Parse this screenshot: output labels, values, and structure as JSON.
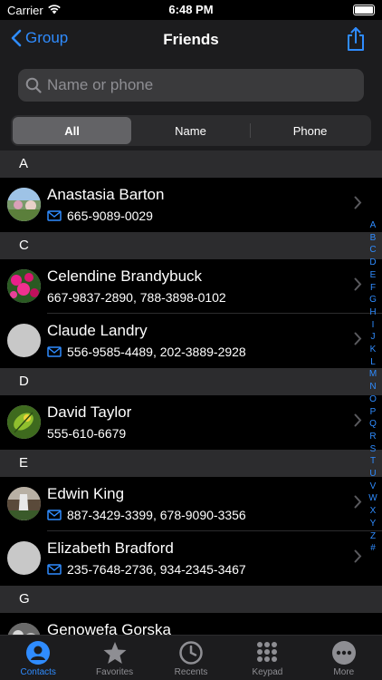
{
  "status_bar": {
    "carrier": "Carrier",
    "time": "6:48 PM"
  },
  "nav": {
    "back_label": "Group",
    "title": "Friends"
  },
  "search": {
    "placeholder": "Name or phone"
  },
  "segments": [
    "All",
    "Name",
    "Phone"
  ],
  "sections": [
    {
      "letter": "A",
      "contacts": [
        {
          "name": "Anastasia Barton",
          "detail": "665-9089-0029",
          "mail_icon": true,
          "avatar": "landscape"
        }
      ]
    },
    {
      "letter": "C",
      "contacts": [
        {
          "name": "Celendine Brandybuck",
          "detail": "667-9837-2890, 788-3898-0102",
          "mail_icon": false,
          "avatar": "flowers"
        },
        {
          "name": "Claude Landry",
          "detail": "556-9585-4489, 202-3889-2928",
          "mail_icon": true,
          "avatar": "blank"
        }
      ]
    },
    {
      "letter": "D",
      "contacts": [
        {
          "name": "David Taylor",
          "detail": "555-610-6679",
          "mail_icon": false,
          "avatar": "leaf"
        }
      ]
    },
    {
      "letter": "E",
      "contacts": [
        {
          "name": "Edwin King",
          "detail": "887-3429-3399, 678-9090-3356",
          "mail_icon": true,
          "avatar": "waterfall"
        },
        {
          "name": "Elizabeth Bradford",
          "detail": "235-7648-2736, 934-2345-3467",
          "mail_icon": true,
          "avatar": "blank"
        }
      ]
    },
    {
      "letter": "G",
      "contacts": [
        {
          "name": "Genowefa Gorska",
          "detail": "",
          "mail_icon": false,
          "avatar": "flowers-grey"
        }
      ]
    }
  ],
  "index_letters": [
    "A",
    "B",
    "C",
    "D",
    "E",
    "F",
    "G",
    "H",
    "I",
    "J",
    "K",
    "L",
    "M",
    "N",
    "O",
    "P",
    "Q",
    "R",
    "S",
    "T",
    "U",
    "V",
    "W",
    "X",
    "Y",
    "Z",
    "#"
  ],
  "tabs": [
    {
      "label": "Contacts",
      "icon": "person-icon",
      "active": true
    },
    {
      "label": "Favorites",
      "icon": "star-icon",
      "active": false
    },
    {
      "label": "Recents",
      "icon": "clock-icon",
      "active": false
    },
    {
      "label": "Keypad",
      "icon": "keypad-icon",
      "active": false
    },
    {
      "label": "More",
      "icon": "more-icon",
      "active": false
    }
  ],
  "colors": {
    "accent": "#2f8cff",
    "section_bg": "#2c2c2e",
    "bar_bg": "#1c1c1e"
  }
}
